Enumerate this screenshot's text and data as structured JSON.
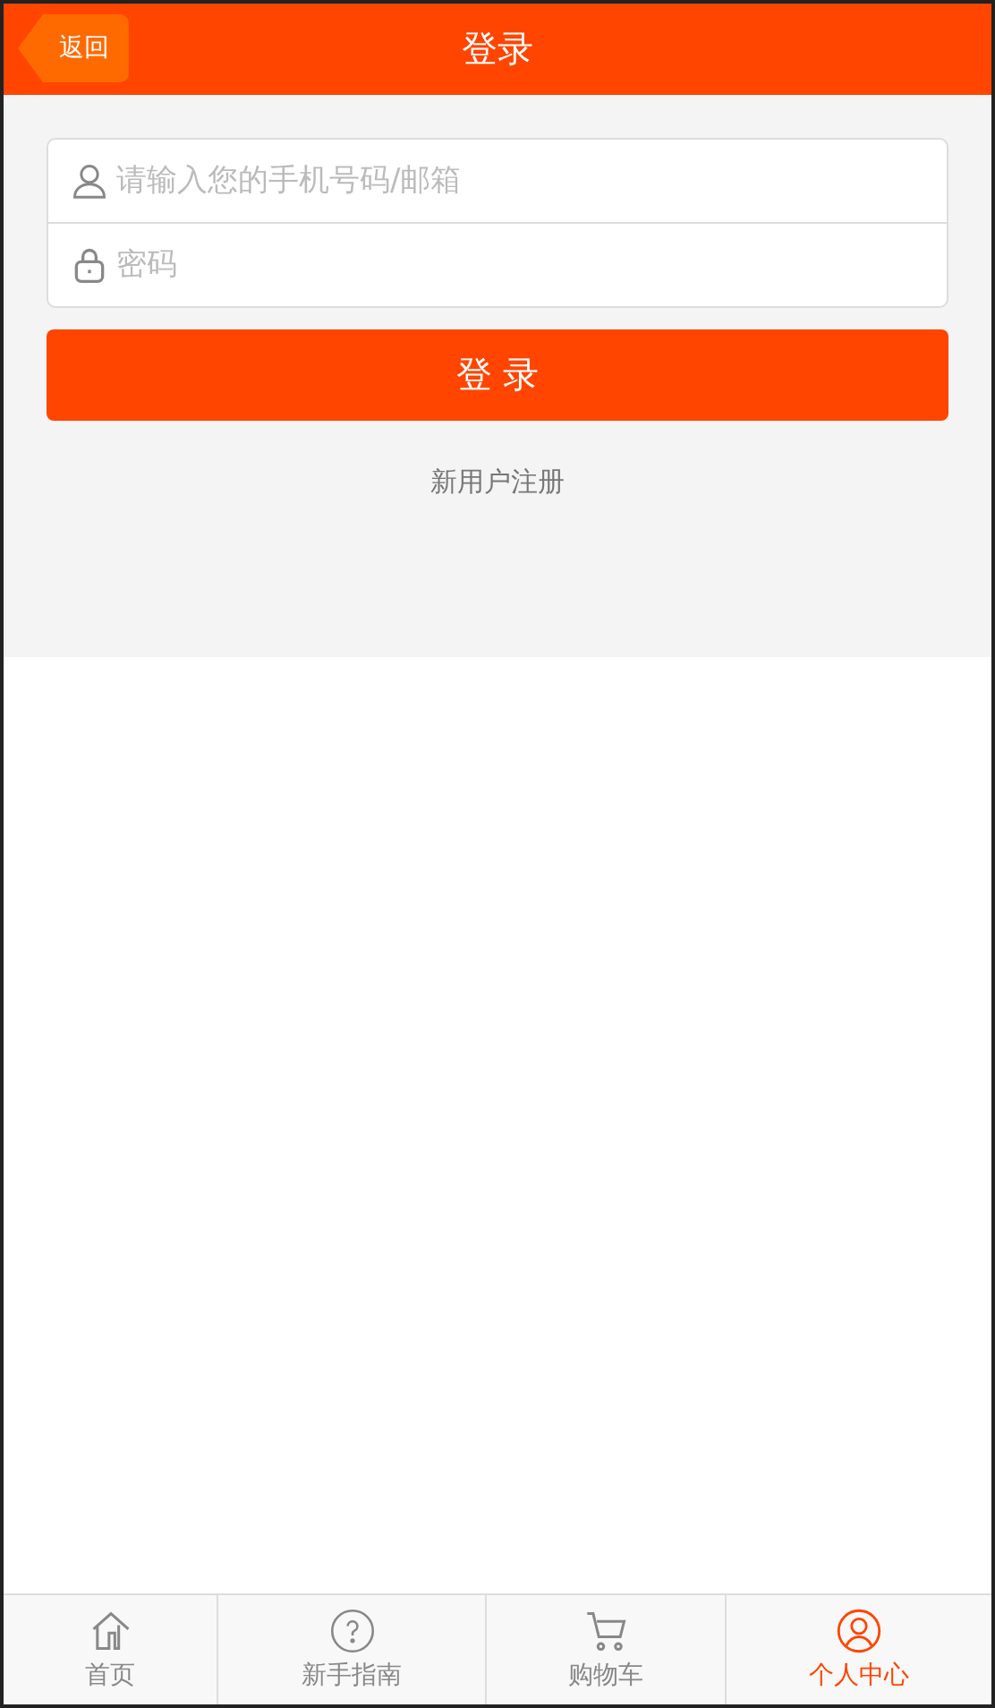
{
  "header": {
    "back": "返回",
    "title": "登录"
  },
  "form": {
    "fields": [
      {
        "kind": "user",
        "placeholder": "请输入您的手机号码/邮箱"
      },
      {
        "kind": "password",
        "placeholder": "密码"
      }
    ],
    "submit": "登 录",
    "register": "新用户注册"
  },
  "tabbar": [
    {
      "kind": "home",
      "label": "首页",
      "selected": false
    },
    {
      "kind": "help",
      "label": "新手指南",
      "selected": false
    },
    {
      "kind": "cart",
      "label": "购物车",
      "selected": false
    },
    {
      "kind": "user",
      "label": "个人中心",
      "selected": true
    }
  ]
}
